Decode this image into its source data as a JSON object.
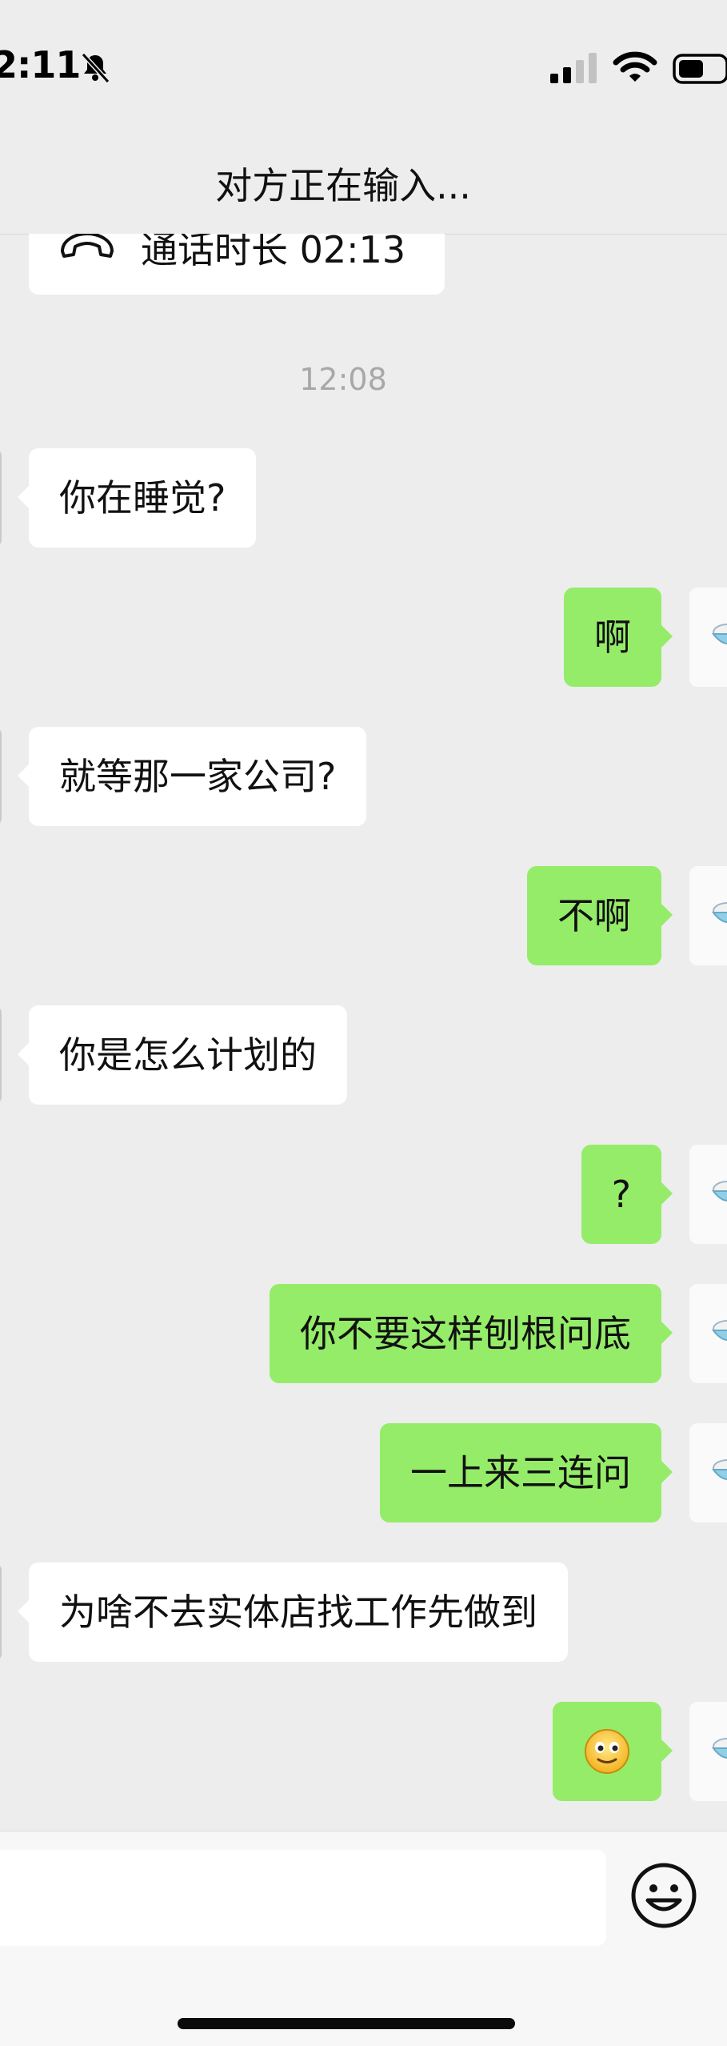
{
  "status_bar": {
    "time": "2:11",
    "bell_icon": "bell-slash-icon",
    "signal_icon": "cellular-signal-icon",
    "wifi_icon": "wifi-icon",
    "battery_icon": "battery-icon"
  },
  "header": {
    "title": "对方正在输入..."
  },
  "chat": {
    "call_record": {
      "icon": "phone-hangup-icon",
      "text": "通话时长 02:13"
    },
    "timestamp": "12:08",
    "messages": [
      {
        "side": "in",
        "text": "你在睡觉?"
      },
      {
        "side": "out",
        "text": "啊"
      },
      {
        "side": "in",
        "text": "就等那一家公司?"
      },
      {
        "side": "out",
        "text": "不啊"
      },
      {
        "side": "in",
        "text": "你是怎么计划的"
      },
      {
        "side": "out",
        "text": "?"
      },
      {
        "side": "out",
        "text": "你不要这样刨根问底"
      },
      {
        "side": "out",
        "text": "一上来三连问"
      },
      {
        "side": "in",
        "text": "为啥不去实体店找工作先做到"
      },
      {
        "side": "out",
        "emoji": "smiling-face-emoji"
      }
    ],
    "avatar_icon": "rice-bowl-icon"
  },
  "input_bar": {
    "emoji_button_icon": "smiley-face-icon"
  },
  "colors": {
    "background": "#ededed",
    "incoming_bubble": "#ffffff",
    "outgoing_bubble": "#95ec69",
    "timestamp_text": "#a8a8a8"
  }
}
